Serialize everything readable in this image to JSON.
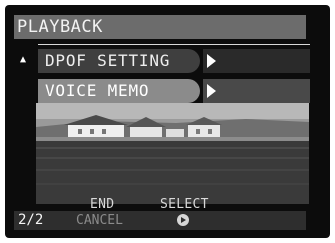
{
  "screen": {
    "title": "PLAYBACK",
    "scroll_indicator_icon": "up-triangle-icon"
  },
  "menu": {
    "items": [
      {
        "label": "DPOF SETTING",
        "submenu_icon": "right-arrow-icon",
        "selected": true
      },
      {
        "label": "VOICE MEMO",
        "submenu_icon": "right-arrow-icon",
        "selected": false
      }
    ]
  },
  "guide": {
    "end_label": "END",
    "select_label": "SELECT"
  },
  "footer": {
    "page_counter": "2/2",
    "cancel_label": "CANCEL",
    "select_icon": "circle-right-icon"
  },
  "colors": {
    "title_bar": "#6c6c6c",
    "highlight": "#8b8b8b",
    "background": "#0c0c0c",
    "text": "#eeeeee"
  }
}
